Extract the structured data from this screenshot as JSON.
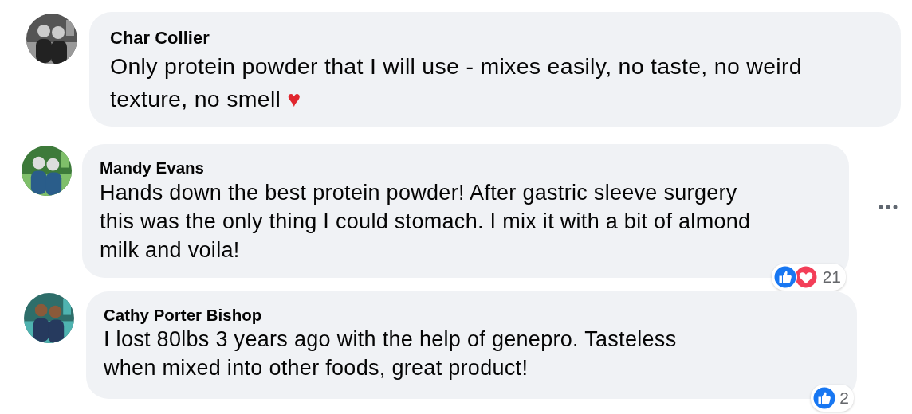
{
  "comments": [
    {
      "author": "Char Collier",
      "text": "Only protein powder that I will use - mixes easily, no taste, no weird texture, no smell",
      "emoji": "♥",
      "show_more": false
    },
    {
      "author": "Mandy Evans",
      "text": "Hands down the best protein powder! After gastric sleeve surgery this was the only thing I could stomach. I mix it with a bit of almond milk and voila!",
      "show_more": true,
      "reactions": {
        "icons": [
          {
            "kind": "like"
          },
          {
            "kind": "love"
          }
        ],
        "count": "21"
      }
    },
    {
      "author": "Cathy Porter Bishop",
      "text": "I lost 80lbs 3 years ago with the help of genepro. Tasteless when mixed into other foods, great product!",
      "show_more": false,
      "reactions": {
        "icons": [
          {
            "kind": "like"
          }
        ],
        "count": "2"
      }
    }
  ]
}
